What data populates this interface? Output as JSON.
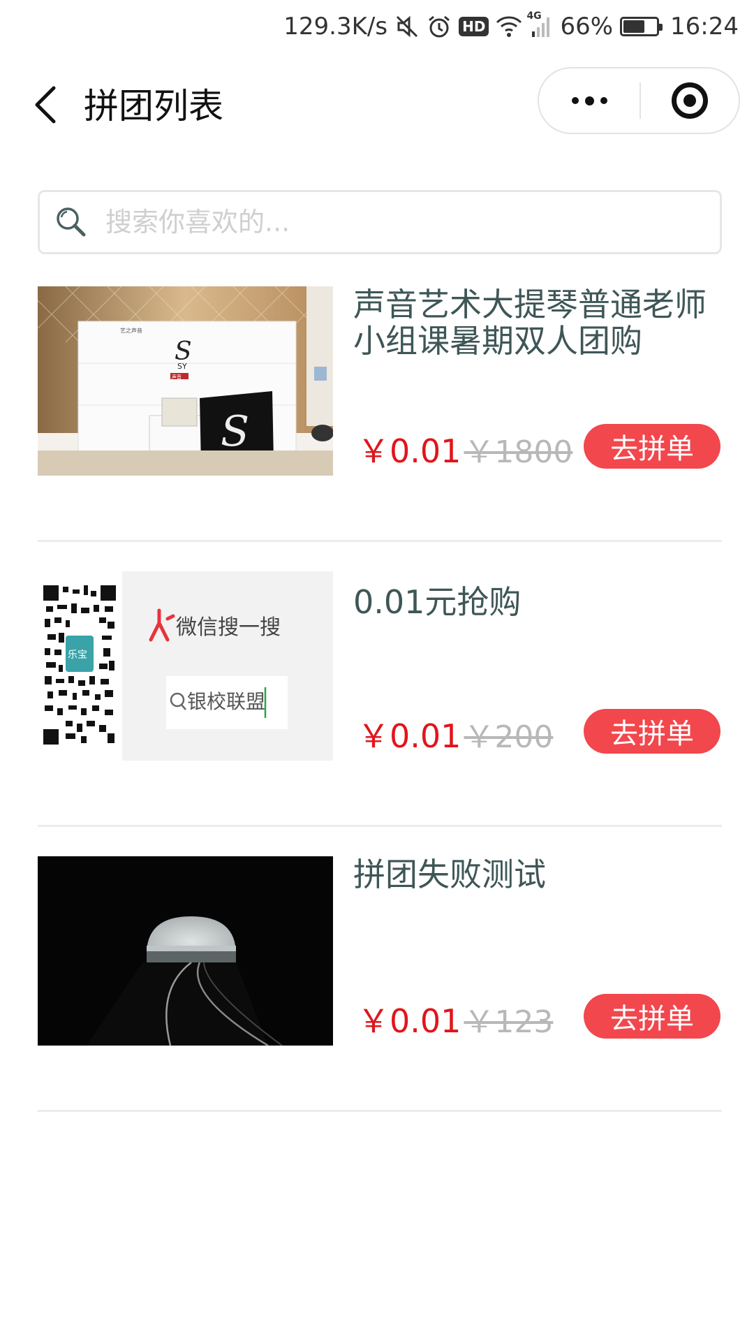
{
  "status_bar": {
    "net_speed": "129.3K/s",
    "signal_label": "4G",
    "battery_text": "66%",
    "battery_level": 0.66,
    "time": "16:24",
    "hd_badge": "HD"
  },
  "nav": {
    "title": "拼团列表",
    "icons": [
      "chevron-left-icon",
      "more-dots-icon",
      "target-close-icon"
    ]
  },
  "search": {
    "placeholder": "搜索你喜欢的...",
    "value": ""
  },
  "items": [
    {
      "title": "声音艺术大提琴普通老师小组课暑期双人团购",
      "price": "￥0.01",
      "original_price": "￥1800",
      "button": "去拼单",
      "image": {
        "type": "studio-photo",
        "wall_text": "艺之声音",
        "logo_text": "SY",
        "brand_text": "声音"
      }
    },
    {
      "title": "0.01元抢购",
      "price": "￥0.01",
      "original_price": "￥200",
      "button": "去拼单",
      "image": {
        "type": "qrcode-promo",
        "badge_text": "乐宝",
        "search_title": "微信搜一搜",
        "search_term": "银校联盟"
      }
    },
    {
      "title": "拼团失败测试",
      "price": "￥0.01",
      "original_price": "￥123",
      "button": "去拼单",
      "image": {
        "type": "tunnel-photo"
      }
    }
  ],
  "colors": {
    "accent_red": "#f2474d",
    "price_red": "#e0151c",
    "title_text": "#3f5656",
    "strike_gray": "#b8b8b8"
  }
}
